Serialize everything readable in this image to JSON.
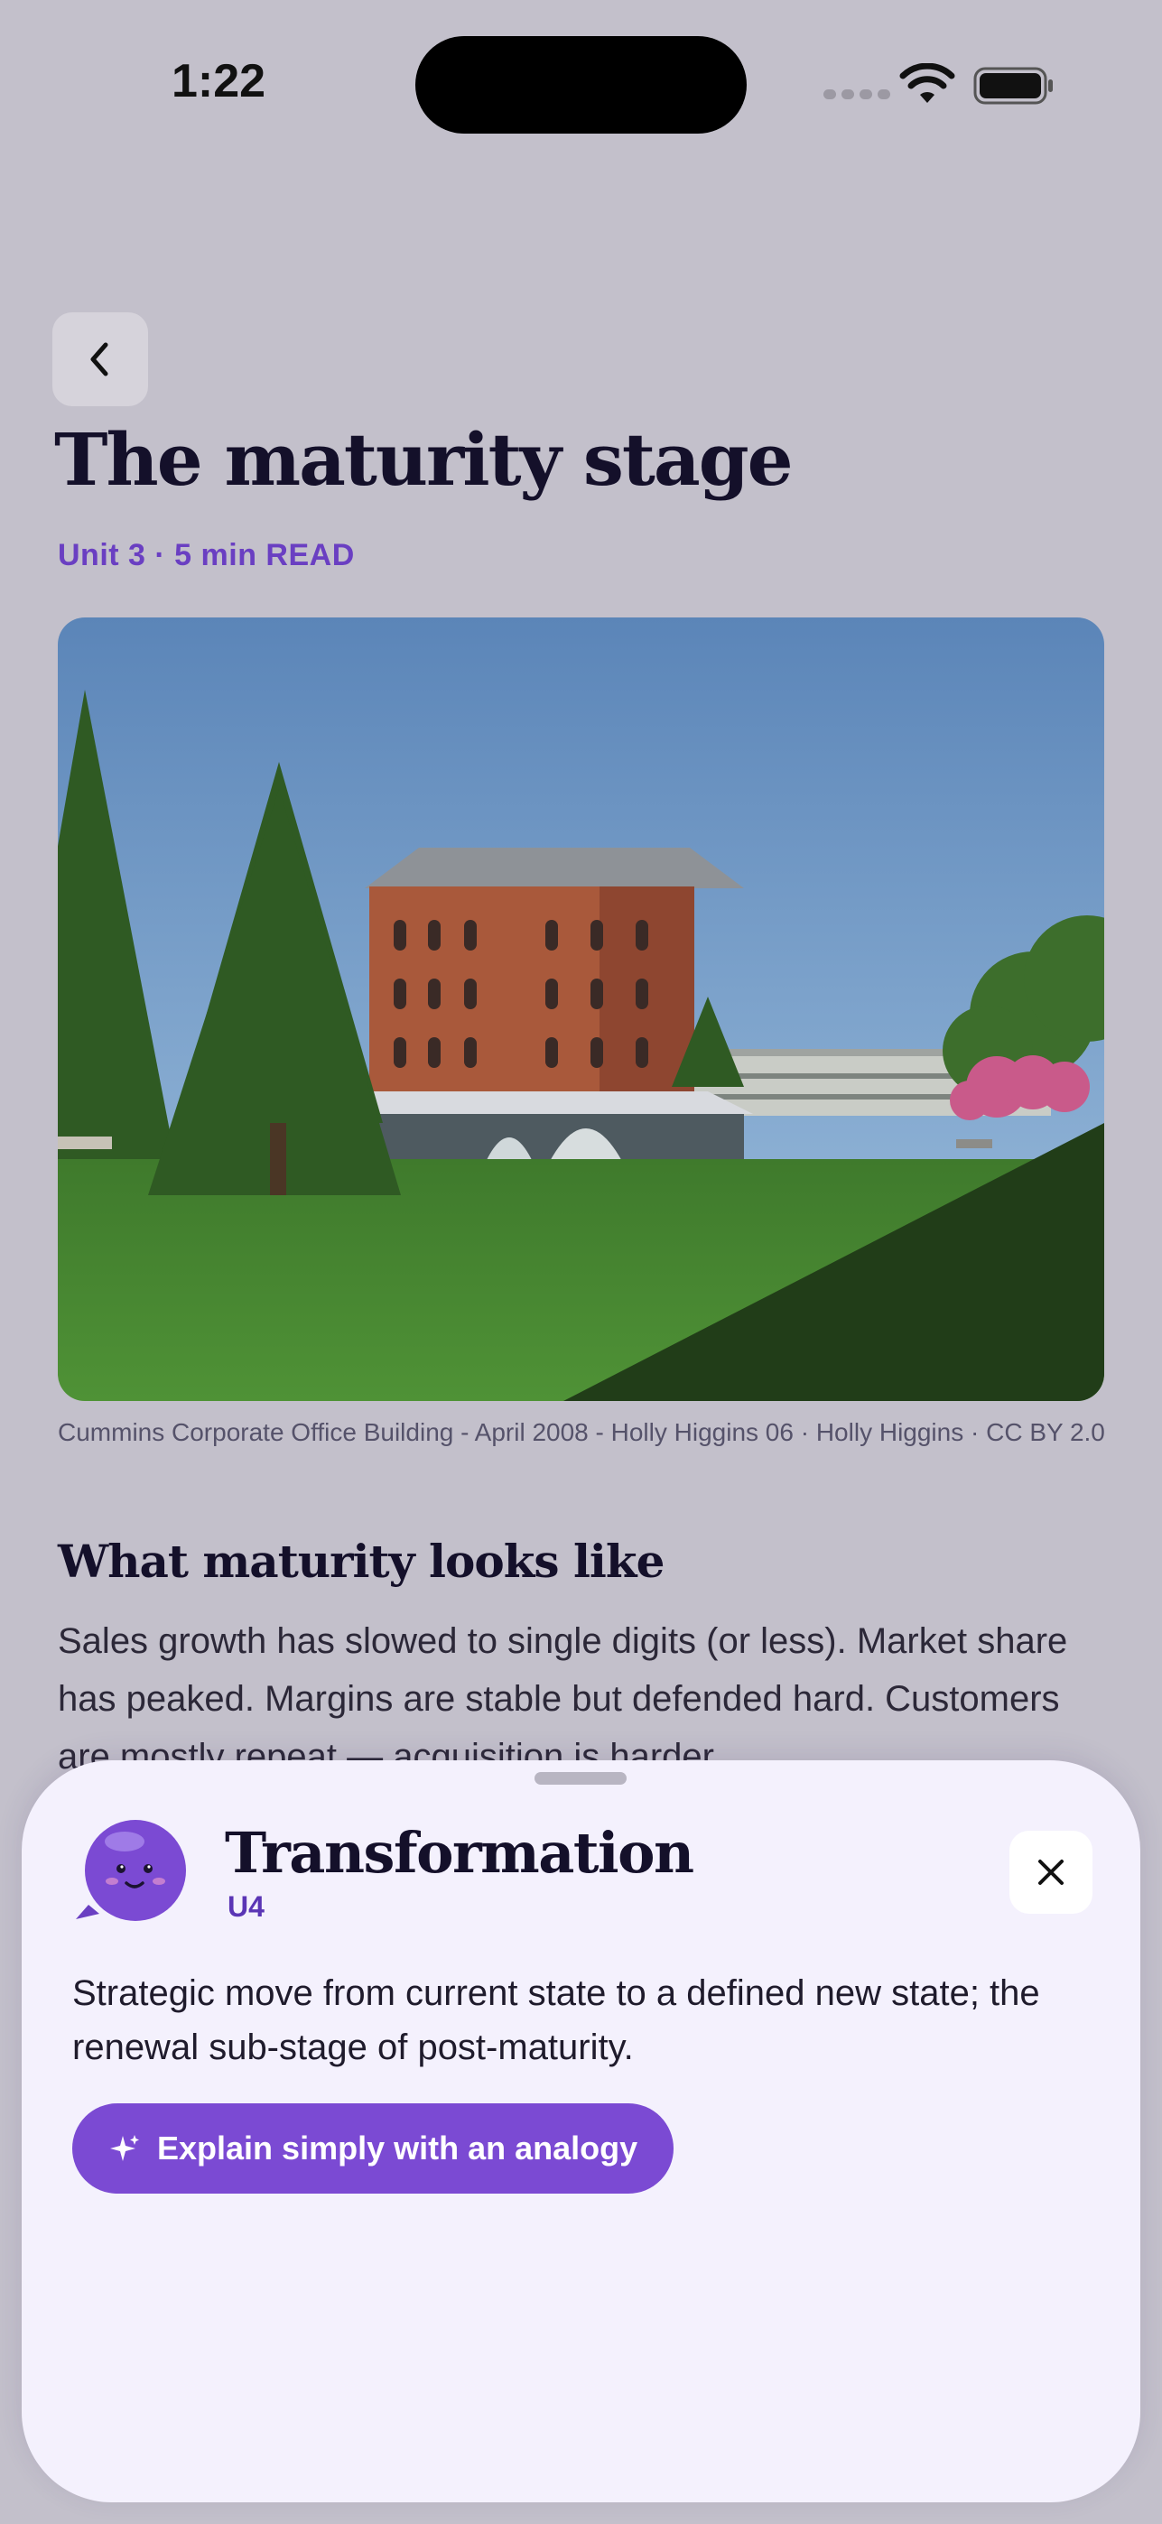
{
  "status_bar": {
    "time": "1:22"
  },
  "header": {
    "back_icon": "chevron-left-icon",
    "title": "The maturity stage",
    "meta": "Unit 3 · 5 min READ"
  },
  "hero": {
    "caption": "Cummins Corporate Office Building - April 2008 - Holly Higgins 06 · Holly Higgins · CC BY 2.0"
  },
  "section": {
    "heading": "What maturity looks like",
    "body": "Sales growth has slowed to single digits (or less). Market share has peaked. Margins are stable but defended hard. Customers are mostly repeat — acquisition is harder."
  },
  "sheet": {
    "mascot_icon": "purple-blob-mascot-icon",
    "term": "Transformation",
    "unit": "U4",
    "close_icon": "close-icon",
    "definition": "Strategic move from current state to a defined new state; the renewal sub-stage of post-maturity.",
    "action_label": "Explain simply with an analogy",
    "action_icon": "sparkle-icon"
  },
  "colors": {
    "background": "#c3c0cb",
    "accent": "#7b4ad3",
    "meta_text": "#6a3fc2",
    "sheet_background": "#f4f1fd"
  }
}
